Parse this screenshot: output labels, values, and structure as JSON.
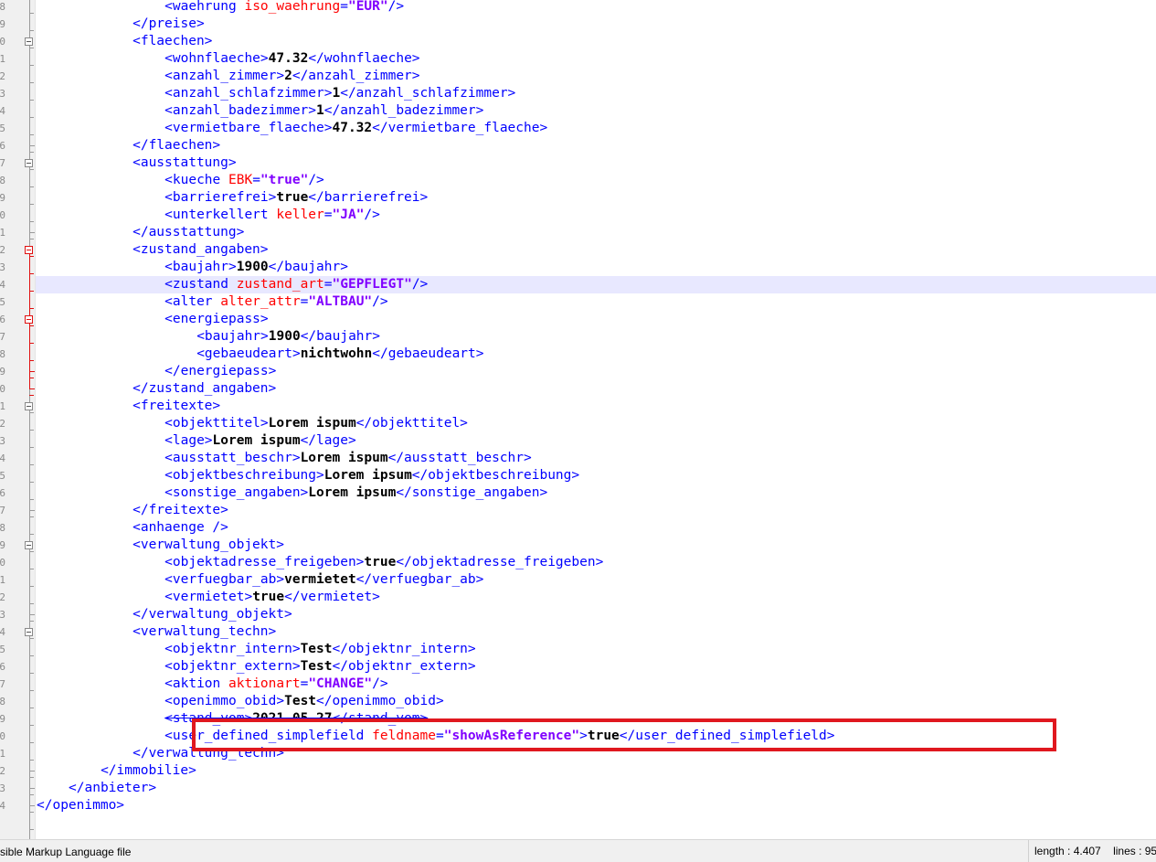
{
  "gutter": {
    "line_numbers": [
      "8",
      "9",
      "0",
      "1",
      "2",
      "3",
      "4",
      "5",
      "6",
      "7",
      "8",
      "9",
      "0",
      "1",
      "2",
      "3",
      "4",
      "5",
      "6",
      "7",
      "8",
      "9",
      "0",
      "1",
      "2",
      "3",
      "4",
      "5",
      "6",
      "7",
      "8",
      "9",
      "0",
      "1",
      "2",
      "3",
      "4",
      "5",
      "6",
      "7",
      "8",
      "9",
      "0",
      "1",
      "2",
      "3",
      "4",
      ""
    ]
  },
  "editor": {
    "lines": [
      [
        {
          "c": "t",
          "s": "<waehrung "
        },
        {
          "c": "a",
          "s": "iso_waehrung"
        },
        {
          "c": "t",
          "s": "="
        },
        {
          "c": "v",
          "s": "\"EUR\""
        },
        {
          "c": "t",
          "s": "/>"
        }
      ],
      [
        {
          "c": "t",
          "s": "</preise>"
        }
      ],
      [
        {
          "c": "t",
          "s": "<flaechen>"
        }
      ],
      [
        {
          "c": "t",
          "s": "<wohnflaeche>"
        },
        {
          "c": "x",
          "s": "47.32"
        },
        {
          "c": "t",
          "s": "</wohnflaeche>"
        }
      ],
      [
        {
          "c": "t",
          "s": "<anzahl_zimmer>"
        },
        {
          "c": "x",
          "s": "2"
        },
        {
          "c": "t",
          "s": "</anzahl_zimmer>"
        }
      ],
      [
        {
          "c": "t",
          "s": "<anzahl_schlafzimmer>"
        },
        {
          "c": "x",
          "s": "1"
        },
        {
          "c": "t",
          "s": "</anzahl_schlafzimmer>"
        }
      ],
      [
        {
          "c": "t",
          "s": "<anzahl_badezimmer>"
        },
        {
          "c": "x",
          "s": "1"
        },
        {
          "c": "t",
          "s": "</anzahl_badezimmer>"
        }
      ],
      [
        {
          "c": "t",
          "s": "<vermietbare_flaeche>"
        },
        {
          "c": "x",
          "s": "47.32"
        },
        {
          "c": "t",
          "s": "</vermietbare_flaeche>"
        }
      ],
      [
        {
          "c": "t",
          "s": "</flaechen>"
        }
      ],
      [
        {
          "c": "t",
          "s": "<ausstattung>"
        }
      ],
      [
        {
          "c": "t",
          "s": "<kueche "
        },
        {
          "c": "a",
          "s": "EBK"
        },
        {
          "c": "t",
          "s": "="
        },
        {
          "c": "v",
          "s": "\"true\""
        },
        {
          "c": "t",
          "s": "/>"
        }
      ],
      [
        {
          "c": "t",
          "s": "<barrierefrei>"
        },
        {
          "c": "x",
          "s": "true"
        },
        {
          "c": "t",
          "s": "</barrierefrei>"
        }
      ],
      [
        {
          "c": "t",
          "s": "<unterkellert "
        },
        {
          "c": "a",
          "s": "keller"
        },
        {
          "c": "t",
          "s": "="
        },
        {
          "c": "v",
          "s": "\"JA\""
        },
        {
          "c": "t",
          "s": "/>"
        }
      ],
      [
        {
          "c": "t",
          "s": "</ausstattung>"
        }
      ],
      [
        {
          "c": "t",
          "s": "<zustand_angaben>"
        }
      ],
      [
        {
          "c": "t",
          "s": "<baujahr>"
        },
        {
          "c": "x",
          "s": "1900"
        },
        {
          "c": "t",
          "s": "</baujahr>"
        }
      ],
      [
        {
          "c": "t",
          "s": "<zustand "
        },
        {
          "c": "a",
          "s": "zustand_art"
        },
        {
          "c": "t",
          "s": "="
        },
        {
          "c": "v",
          "s": "\"GEPFLEGT\""
        },
        {
          "c": "t",
          "s": "/>"
        }
      ],
      [
        {
          "c": "t",
          "s": "<alter "
        },
        {
          "c": "a",
          "s": "alter_attr"
        },
        {
          "c": "t",
          "s": "="
        },
        {
          "c": "v",
          "s": "\"ALTBAU\""
        },
        {
          "c": "t",
          "s": "/>"
        }
      ],
      [
        {
          "c": "t",
          "s": "<energiepass>"
        }
      ],
      [
        {
          "c": "t",
          "s": "<baujahr>"
        },
        {
          "c": "x",
          "s": "1900"
        },
        {
          "c": "t",
          "s": "</baujahr>"
        }
      ],
      [
        {
          "c": "t",
          "s": "<gebaeudeart>"
        },
        {
          "c": "x",
          "s": "nichtwohn"
        },
        {
          "c": "t",
          "s": "</gebaeudeart>"
        }
      ],
      [
        {
          "c": "t",
          "s": "</energiepass>"
        }
      ],
      [
        {
          "c": "t",
          "s": "</zustand_angaben>"
        }
      ],
      [
        {
          "c": "t",
          "s": "<freitexte>"
        }
      ],
      [
        {
          "c": "t",
          "s": "<objekttitel>"
        },
        {
          "c": "x",
          "s": "Lorem ispum"
        },
        {
          "c": "t",
          "s": "</objekttitel>"
        }
      ],
      [
        {
          "c": "t",
          "s": "<lage>"
        },
        {
          "c": "x",
          "s": "Lorem ispum"
        },
        {
          "c": "t",
          "s": "</lage>"
        }
      ],
      [
        {
          "c": "t",
          "s": "<ausstatt_beschr>"
        },
        {
          "c": "x",
          "s": "Lorem ispum"
        },
        {
          "c": "t",
          "s": "</ausstatt_beschr>"
        }
      ],
      [
        {
          "c": "t",
          "s": "<objektbeschreibung>"
        },
        {
          "c": "x",
          "s": "Lorem ipsum"
        },
        {
          "c": "t",
          "s": "</objektbeschreibung>"
        }
      ],
      [
        {
          "c": "t",
          "s": "<sonstige_angaben>"
        },
        {
          "c": "x",
          "s": "Lorem ipsum"
        },
        {
          "c": "t",
          "s": "</sonstige_angaben>"
        }
      ],
      [
        {
          "c": "t",
          "s": "</freitexte>"
        }
      ],
      [
        {
          "c": "t",
          "s": "<anhaenge />"
        }
      ],
      [
        {
          "c": "t",
          "s": "<verwaltung_objekt>"
        }
      ],
      [
        {
          "c": "t",
          "s": "<objektadresse_freigeben>"
        },
        {
          "c": "x",
          "s": "true"
        },
        {
          "c": "t",
          "s": "</objektadresse_freigeben>"
        }
      ],
      [
        {
          "c": "t",
          "s": "<verfuegbar_ab>"
        },
        {
          "c": "x",
          "s": "vermietet"
        },
        {
          "c": "t",
          "s": "</verfuegbar_ab>"
        }
      ],
      [
        {
          "c": "t",
          "s": "<vermietet>"
        },
        {
          "c": "x",
          "s": "true"
        },
        {
          "c": "t",
          "s": "</vermietet>"
        }
      ],
      [
        {
          "c": "t",
          "s": "</verwaltung_objekt>"
        }
      ],
      [
        {
          "c": "t",
          "s": "<verwaltung_techn>"
        }
      ],
      [
        {
          "c": "t",
          "s": "<objektnr_intern>"
        },
        {
          "c": "x",
          "s": "Test"
        },
        {
          "c": "t",
          "s": "</objektnr_intern>"
        }
      ],
      [
        {
          "c": "t",
          "s": "<objektnr_extern>"
        },
        {
          "c": "x",
          "s": "Test"
        },
        {
          "c": "t",
          "s": "</objektnr_extern>"
        }
      ],
      [
        {
          "c": "t",
          "s": "<aktion "
        },
        {
          "c": "a",
          "s": "aktionart"
        },
        {
          "c": "t",
          "s": "="
        },
        {
          "c": "v",
          "s": "\"CHANGE\""
        },
        {
          "c": "t",
          "s": "/>"
        }
      ],
      [
        {
          "c": "t",
          "s": "<openimmo_obid>"
        },
        {
          "c": "x",
          "s": "Test"
        },
        {
          "c": "t",
          "s": "</openimmo_obid>"
        }
      ],
      [
        {
          "c": "t",
          "s": "<stand_vom>"
        },
        {
          "c": "x",
          "s": "2021-05-27"
        },
        {
          "c": "t",
          "s": "</stand_vom>"
        }
      ],
      [
        {
          "c": "t",
          "s": "<user_defined_simplefield "
        },
        {
          "c": "a",
          "s": "feldname"
        },
        {
          "c": "t",
          "s": "="
        },
        {
          "c": "v",
          "s": "\"showAsReference\""
        },
        {
          "c": "t",
          "s": ">"
        },
        {
          "c": "x",
          "s": "true"
        },
        {
          "c": "t",
          "s": "</user_defined_simplefield>"
        }
      ],
      [
        {
          "c": "t",
          "s": "</verwaltung_techn>"
        }
      ],
      [
        {
          "c": "t",
          "s": "</immobilie>"
        }
      ],
      [
        {
          "c": "t",
          "s": "</anbieter>"
        }
      ],
      [
        {
          "c": "t",
          "s": "</openimmo>"
        }
      ],
      []
    ]
  },
  "statusbar": {
    "file_type": "sible Markup Language file",
    "length": "length : 4.407",
    "lines": "lines : 95"
  }
}
